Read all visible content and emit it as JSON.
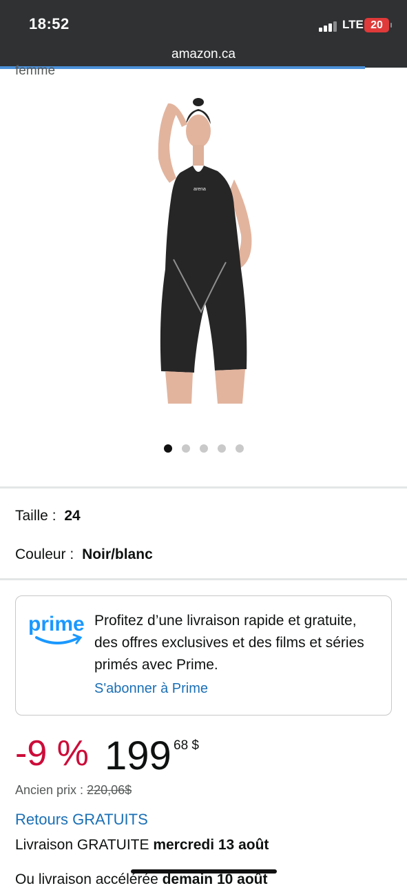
{
  "status_bar": {
    "time": "18:52",
    "network": "LTE",
    "battery": "20"
  },
  "browser": {
    "url": "amazon.ca"
  },
  "partial_title": "femme",
  "image_carousel": {
    "count": 5,
    "active_index": 0
  },
  "attributes": {
    "size_label": "Taille :",
    "size_value": "24",
    "color_label": "Couleur :",
    "color_value": "Noir/blanc"
  },
  "prime": {
    "logo_text": "prime",
    "message": "Profitez d’une livraison rapide et gratuite, des offres exclusives et des films et séries primés avec Prime.",
    "link": "S'abonner à Prime"
  },
  "price": {
    "discount": "-9 %",
    "whole": "199",
    "fraction": "68 $",
    "old_label": "Ancien prix :",
    "old_value": "220,06$"
  },
  "returns": "Retours GRATUITS",
  "delivery": {
    "prefix": "Livraison GRATUITE ",
    "date": "mercredi 13 août"
  },
  "fast_delivery": {
    "prefix": "Ou livraison accélérée ",
    "date": "demain 10 août"
  },
  "colors": {
    "accent_red": "#cc0c39",
    "link_blue": "#1a6fb5",
    "prime_blue": "#1a98ff"
  }
}
